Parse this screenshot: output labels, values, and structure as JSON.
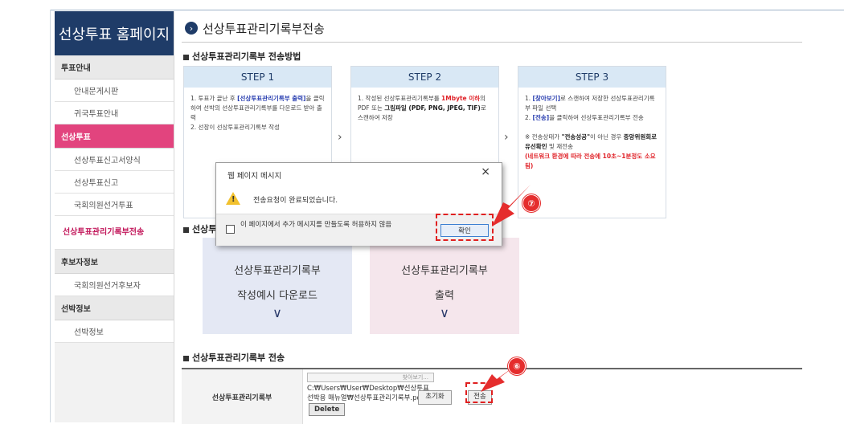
{
  "sidebar": {
    "header": "선상투표 홈페이지",
    "sections": [
      {
        "category": "투표안내",
        "items": [
          "안내문게시판",
          "귀국투표안내"
        ]
      },
      {
        "category": "선상투표",
        "items": [
          "선상투표신고서양식",
          "선상투표신고",
          "국회의원선거투표",
          "선상투표관리기록부전송"
        ],
        "active_item": "선상투표관리기록부전송"
      },
      {
        "category": "후보자정보",
        "items": [
          "국회의원선거후보자"
        ]
      },
      {
        "category": "선박정보",
        "items": [
          "선박정보"
        ]
      }
    ]
  },
  "page": {
    "title": "선상투표관리기록부전송",
    "section1_title": "선상투표관리기록부 전송방법",
    "section2_title_visible": "선상투",
    "section3_title": "선상투표관리기록부 전송"
  },
  "steps": [
    {
      "label": "STEP 1"
    },
    {
      "label": "STEP 2"
    },
    {
      "label": "STEP 3"
    }
  ],
  "step_text": {
    "s1_a": "1. 투표가 끝난 후 ",
    "s1_b": "[선상투표관리기록부 출력]",
    "s1_c": "을 클릭하여 선박의 선상투표관리기록부를 다운로드 받아 출력",
    "s1_d": "2. 선장이 선상투표관리기록부 작성",
    "s2_a": "1. 작성된 선상투표관리기록부를 ",
    "s2_b": "1Mbyte 이하",
    "s2_c": "의 PDF 또는 ",
    "s2_d": "그림파일 (PDF, PNG, JPEG, TIF)",
    "s2_e": "로 스캔하여 저장",
    "s3_a": "1. ",
    "s3_b": "[찾아보기]",
    "s3_c": "로 스캔하여 저장한 선상투표관리기록부 파일 선택",
    "s3_d": "2. ",
    "s3_e": "[전송]",
    "s3_f": "을 클릭하여 선상투표관리기록부 전송",
    "s3_g": "※ 전송상태가 ",
    "s3_h": "\"전송성공\"",
    "s3_i": "이 아닌 경우 ",
    "s3_j": "중앙위원회로 유선확인",
    "s3_k": " 및 재전송",
    "s3_l": "(네트워크 환경에 따라 전송에 10초~1분정도 소요됨)"
  },
  "downloads": {
    "left": {
      "line1": "선상투표관리기록부",
      "line2": "작성예시 다운로드"
    },
    "right": {
      "line1": "선상투표관리기록부",
      "line2": "출력"
    }
  },
  "transfer": {
    "label": "선상투표관리기록부",
    "find_button": "찾아보기...",
    "file_path": "C:₩Users₩User₩Desktop₩선상투표 선박용 매뉴얼₩선상투표관리기록부.pdf",
    "delete_button": "Delete",
    "reset_button": "초기화",
    "send_button": "전송"
  },
  "dialog": {
    "title": "웹 페이지 메시지",
    "message": "전송요청이 완료되었습니다.",
    "checkbox_label": "이 페이지에서 추가 메시지를 만들도록 허용하지 않음",
    "ok_button": "확인",
    "close_symbol": "×"
  },
  "callouts": {
    "step6": "⑥",
    "step7": "⑦"
  },
  "colors": {
    "navy": "#1f3c68",
    "pink": "#e2447e",
    "red": "#e02020",
    "step_head": "#d9e8f5"
  }
}
